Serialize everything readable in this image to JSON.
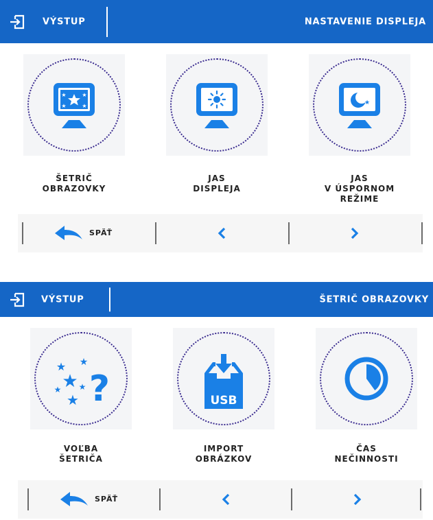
{
  "screens": [
    {
      "header": {
        "exit_label": "VÝSTUP",
        "title": "NASTAVENIE DISPLEJA"
      },
      "tiles": [
        {
          "icon": "monitor-stars-icon",
          "caption_lines": [
            "ŠETRIČ",
            "OBRAZOVKY"
          ]
        },
        {
          "icon": "monitor-sun-icon",
          "caption_lines": [
            "JAS",
            "DISPLEJA"
          ]
        },
        {
          "icon": "monitor-moon-icon",
          "caption_lines": [
            "JAS",
            "V ÚSPORNOM",
            "REŽIME"
          ]
        }
      ],
      "nav": {
        "back_label": "SPÄŤ"
      }
    },
    {
      "header": {
        "exit_label": "VÝSTUP",
        "title": "ŠETRIČ OBRAZOVKY"
      },
      "tiles": [
        {
          "icon": "stars-question-icon",
          "caption_lines": [
            "VOĽBA",
            "ŠETRIČA"
          ]
        },
        {
          "icon": "usb-import-icon",
          "caption_lines": [
            "IMPORT",
            "OBRÁZKOV"
          ],
          "icon_text": "USB"
        },
        {
          "icon": "clock-icon",
          "caption_lines": [
            "ČAS",
            "NEČINNOSTI"
          ]
        }
      ],
      "nav": {
        "back_label": "SPÄŤ"
      }
    }
  ],
  "colors": {
    "header_bg": "#1566c6",
    "icon_blue": "#1a80e6",
    "ring": "#3a2b8f"
  }
}
